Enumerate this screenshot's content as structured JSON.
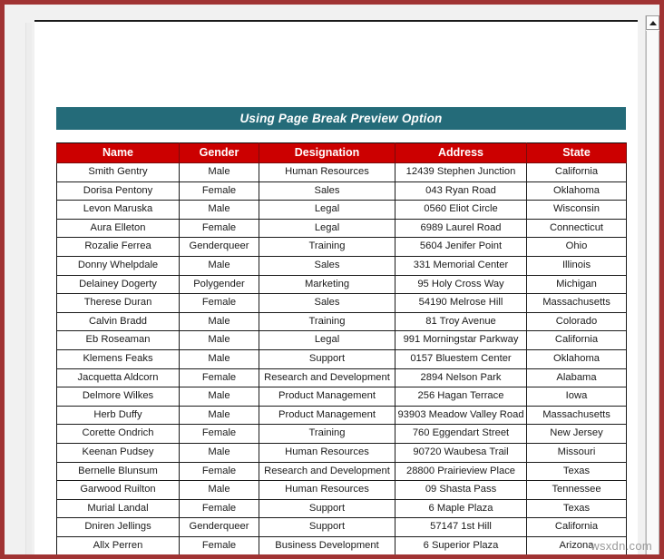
{
  "window": {
    "frame_color": "#a03333",
    "workspace_color": "#f1f1f1",
    "page_color": "#ffffff"
  },
  "sheet": {
    "title": "Using Page Break Preview Option",
    "title_bar_color": "#246b79",
    "title_text_color": "#ffffff"
  },
  "table": {
    "header_bg_color": "#cc0000",
    "header_text_color": "#ffffff",
    "border_color": "#1a1a1a",
    "columns": [
      "Name",
      "Gender",
      "Designation",
      "Address",
      "State"
    ],
    "rows": [
      [
        "Smith Gentry",
        "Male",
        "Human Resources",
        "12439 Stephen Junction",
        "California"
      ],
      [
        "Dorisa Pentony",
        "Female",
        "Sales",
        "043 Ryan Road",
        "Oklahoma"
      ],
      [
        "Levon Maruska",
        "Male",
        "Legal",
        "0560 Eliot Circle",
        "Wisconsin"
      ],
      [
        "Aura Elleton",
        "Female",
        "Legal",
        "6989 Laurel Road",
        "Connecticut"
      ],
      [
        "Rozalie Ferrea",
        "Genderqueer",
        "Training",
        "5604 Jenifer Point",
        "Ohio"
      ],
      [
        "Donny Whelpdale",
        "Male",
        "Sales",
        "331 Memorial Center",
        "Illinois"
      ],
      [
        "Delainey Dogerty",
        "Polygender",
        "Marketing",
        "95 Holy Cross Way",
        "Michigan"
      ],
      [
        "Therese Duran",
        "Female",
        "Sales",
        "54190 Melrose Hill",
        "Massachusetts"
      ],
      [
        "Calvin Bradd",
        "Male",
        "Training",
        "81 Troy Avenue",
        "Colorado"
      ],
      [
        "Eb Roseaman",
        "Male",
        "Legal",
        "991 Morningstar Parkway",
        "California"
      ],
      [
        "Klemens Feaks",
        "Male",
        "Support",
        "0157 Bluestem Center",
        "Oklahoma"
      ],
      [
        "Jacquetta Aldcorn",
        "Female",
        "Research and Development",
        "2894 Nelson Park",
        "Alabama"
      ],
      [
        "Delmore Wilkes",
        "Male",
        "Product Management",
        "256 Hagan Terrace",
        "Iowa"
      ],
      [
        "Herb Duffy",
        "Male",
        "Product Management",
        "93903 Meadow Valley Road",
        "Massachusetts"
      ],
      [
        "Corette Ondrich",
        "Female",
        "Training",
        "760 Eggendart Street",
        "New Jersey"
      ],
      [
        "Keenan Pudsey",
        "Male",
        "Human Resources",
        "90720 Waubesa Trail",
        "Missouri"
      ],
      [
        "Bernelle Blunsum",
        "Female",
        "Research and Development",
        "28800 Prairieview Place",
        "Texas"
      ],
      [
        "Garwood Ruilton",
        "Male",
        "Human Resources",
        "09 Shasta Pass",
        "Tennessee"
      ],
      [
        "Murial Landal",
        "Female",
        "Support",
        "6 Maple Plaza",
        "Texas"
      ],
      [
        "Dniren Jellings",
        "Genderqueer",
        "Support",
        "57147 1st Hill",
        "California"
      ],
      [
        "Allx Perren",
        "Female",
        "Business Development",
        "6 Superior Plaza",
        "Arizona"
      ]
    ]
  },
  "scrollbar": {
    "up_arrow_icon": "triangle-up-icon"
  },
  "watermark": {
    "text": "wsxdn.com"
  }
}
